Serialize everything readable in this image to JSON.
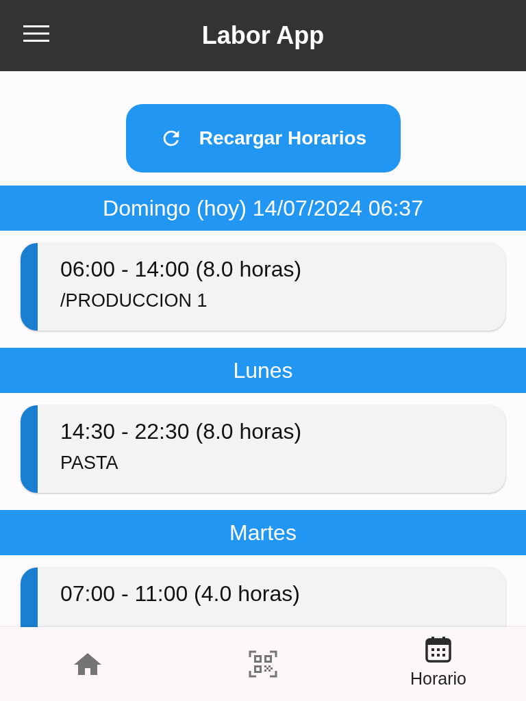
{
  "app_bar": {
    "title": "Labor App"
  },
  "reload_button": {
    "label": "Recargar Horarios"
  },
  "days": [
    {
      "heading": "Domingo (hoy) 14/07/2024 06:37",
      "shifts": [
        {
          "time": "06:00 - 14:00 (8.0 horas)",
          "area": "/PRODUCCION 1"
        }
      ]
    },
    {
      "heading": "Lunes",
      "shifts": [
        {
          "time": "14:30 - 22:30 (8.0 horas)",
          "area": "PASTA"
        }
      ]
    },
    {
      "heading": "Martes",
      "shifts": [
        {
          "time": "07:00 - 11:00 (4.0 horas)"
        }
      ]
    }
  ],
  "bottom_nav": [
    {
      "kind": "home",
      "selected": false
    },
    {
      "kind": "qr",
      "selected": false
    },
    {
      "kind": "calendar",
      "selected": true,
      "label": "Horario"
    }
  ]
}
